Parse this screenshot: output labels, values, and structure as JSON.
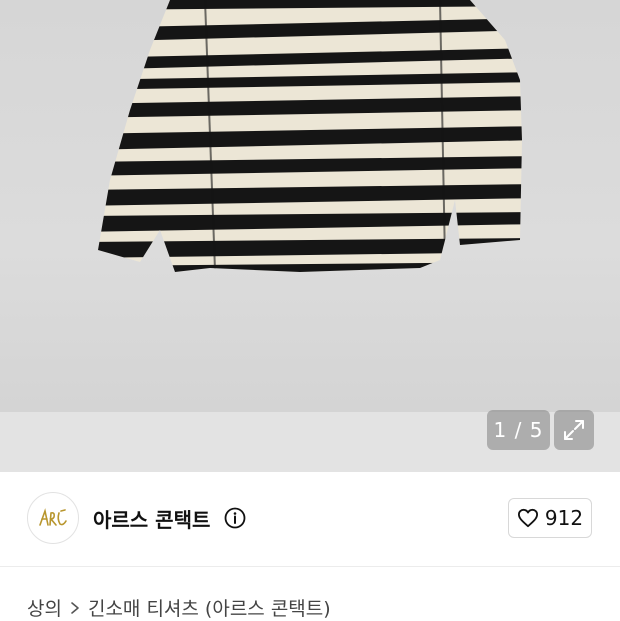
{
  "gallery": {
    "counter": "1 / 5",
    "image_description_icon": "expand-icon"
  },
  "brand": {
    "name": "아르스 콘택트",
    "logo_icon": "brand-logo-icon",
    "info_icon": "info-icon"
  },
  "like": {
    "count": "912",
    "icon": "heart-icon"
  },
  "breadcrumb": {
    "items": [
      "상의",
      "긴소매 티셔츠 (아르스 콘택트)"
    ],
    "separator_icon": "chevron-right-icon"
  },
  "colors": {
    "stripe_dark": "#151515",
    "stripe_light": "#ece6d6",
    "logo_gold": "#b8962e"
  }
}
